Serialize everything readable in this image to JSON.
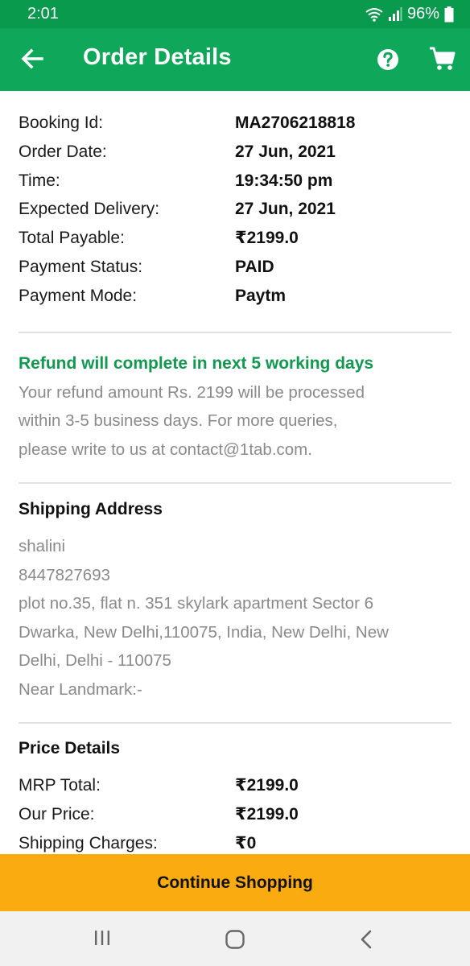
{
  "status_bar": {
    "time": "2:01",
    "battery": "96%"
  },
  "header": {
    "title": "Order Details"
  },
  "order": [
    {
      "label": "Booking Id:",
      "value": "MA2706218818"
    },
    {
      "label": "Order Date:",
      "value": "27 Jun, 2021"
    },
    {
      "label": "Time:",
      "value": "19:34:50 pm"
    },
    {
      "label": "Expected Delivery:",
      "value": "27 Jun, 2021"
    },
    {
      "label": "Total Payable:",
      "value": "₹2199.0"
    },
    {
      "label": "Payment Status:",
      "value": "PAID"
    },
    {
      "label": "Payment Mode:",
      "value": "Paytm"
    }
  ],
  "refund": {
    "title": "Refund will complete in next 5 working days",
    "lines": [
      "Your refund amount Rs. 2199 will be processed",
      "within 3-5 business days. For more queries,",
      "please write to us at contact@1tab.com."
    ]
  },
  "shipping": {
    "title": "Shipping Address",
    "lines": [
      "shalini",
      "8447827693",
      "plot no.35, flat n. 351 skylark apartment Sector 6",
      "Dwarka, New Delhi,110075, India, New Delhi, New",
      "Delhi, Delhi - 110075",
      "Near Landmark:-"
    ]
  },
  "price": {
    "title": "Price Details",
    "rows": [
      {
        "label": "MRP Total:",
        "value": "₹2199.0"
      },
      {
        "label": "Our Price:",
        "value": "₹2199.0"
      },
      {
        "label": "Shipping Charges:",
        "value": "₹0"
      }
    ]
  },
  "bottom_button": {
    "label": "Continue Shopping"
  },
  "colors": {
    "statusbar": "#0a9a4e",
    "appbar": "#0fa85a",
    "accent_green": "#11994f",
    "button": "#f9ab10"
  },
  "icons": [
    "back-arrow-icon",
    "help-icon",
    "cart-icon",
    "wifi-icon",
    "signal-icon",
    "battery-icon",
    "recent-apps-icon",
    "home-icon",
    "back-nav-icon"
  ]
}
